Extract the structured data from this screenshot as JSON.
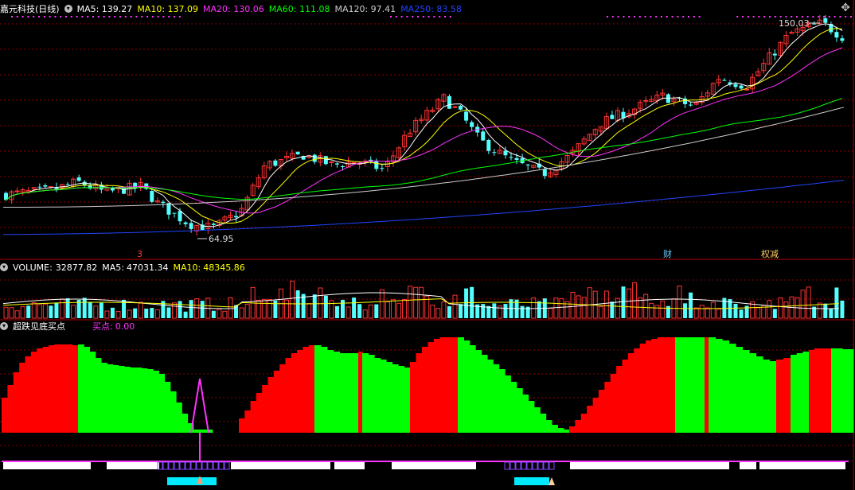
{
  "stock": {
    "name": "嘉元科技",
    "period": "(日线)"
  },
  "price_panel": {
    "ma": [
      {
        "label": "MA5:",
        "value": "139.27",
        "color": "#ffffff"
      },
      {
        "label": "MA10:",
        "value": "137.09",
        "color": "#ffff00"
      },
      {
        "label": "MA20:",
        "value": "130.06",
        "color": "#ff33ff"
      },
      {
        "label": "MA60:",
        "value": "111.08",
        "color": "#00ff00"
      },
      {
        "label": "MA120:",
        "value": "97.41",
        "color": "#cccccc"
      },
      {
        "label": "MA250:",
        "value": "83.58",
        "color": "#2244ff"
      }
    ],
    "high_label": "150.03",
    "low_label": "64.95",
    "markers": [
      {
        "text": "3",
        "color": "#ff3333"
      },
      {
        "text": "财",
        "color": "#66ccff"
      },
      {
        "text": "权减",
        "color": "#ffcc66"
      }
    ]
  },
  "volume_panel": {
    "title": "VOLUME:",
    "volume": "32877.82",
    "ma5_label": "MA5:",
    "ma5": "47031.34",
    "ma10_label": "MA10:",
    "ma10": "48345.86"
  },
  "indicator_panel": {
    "title": "超跌见底买点",
    "buy_label": "买点:",
    "buy_value": "0.00"
  },
  "colors": {
    "up": "#ff3333",
    "down": "#54ffff",
    "ind_up": "#ff0000",
    "ind_down": "#00ff00",
    "grid": "#8b0000",
    "buy": "#ff33ff"
  },
  "toolbar": {
    "icon": "crosshair-icon",
    "glyph": "✥"
  }
}
